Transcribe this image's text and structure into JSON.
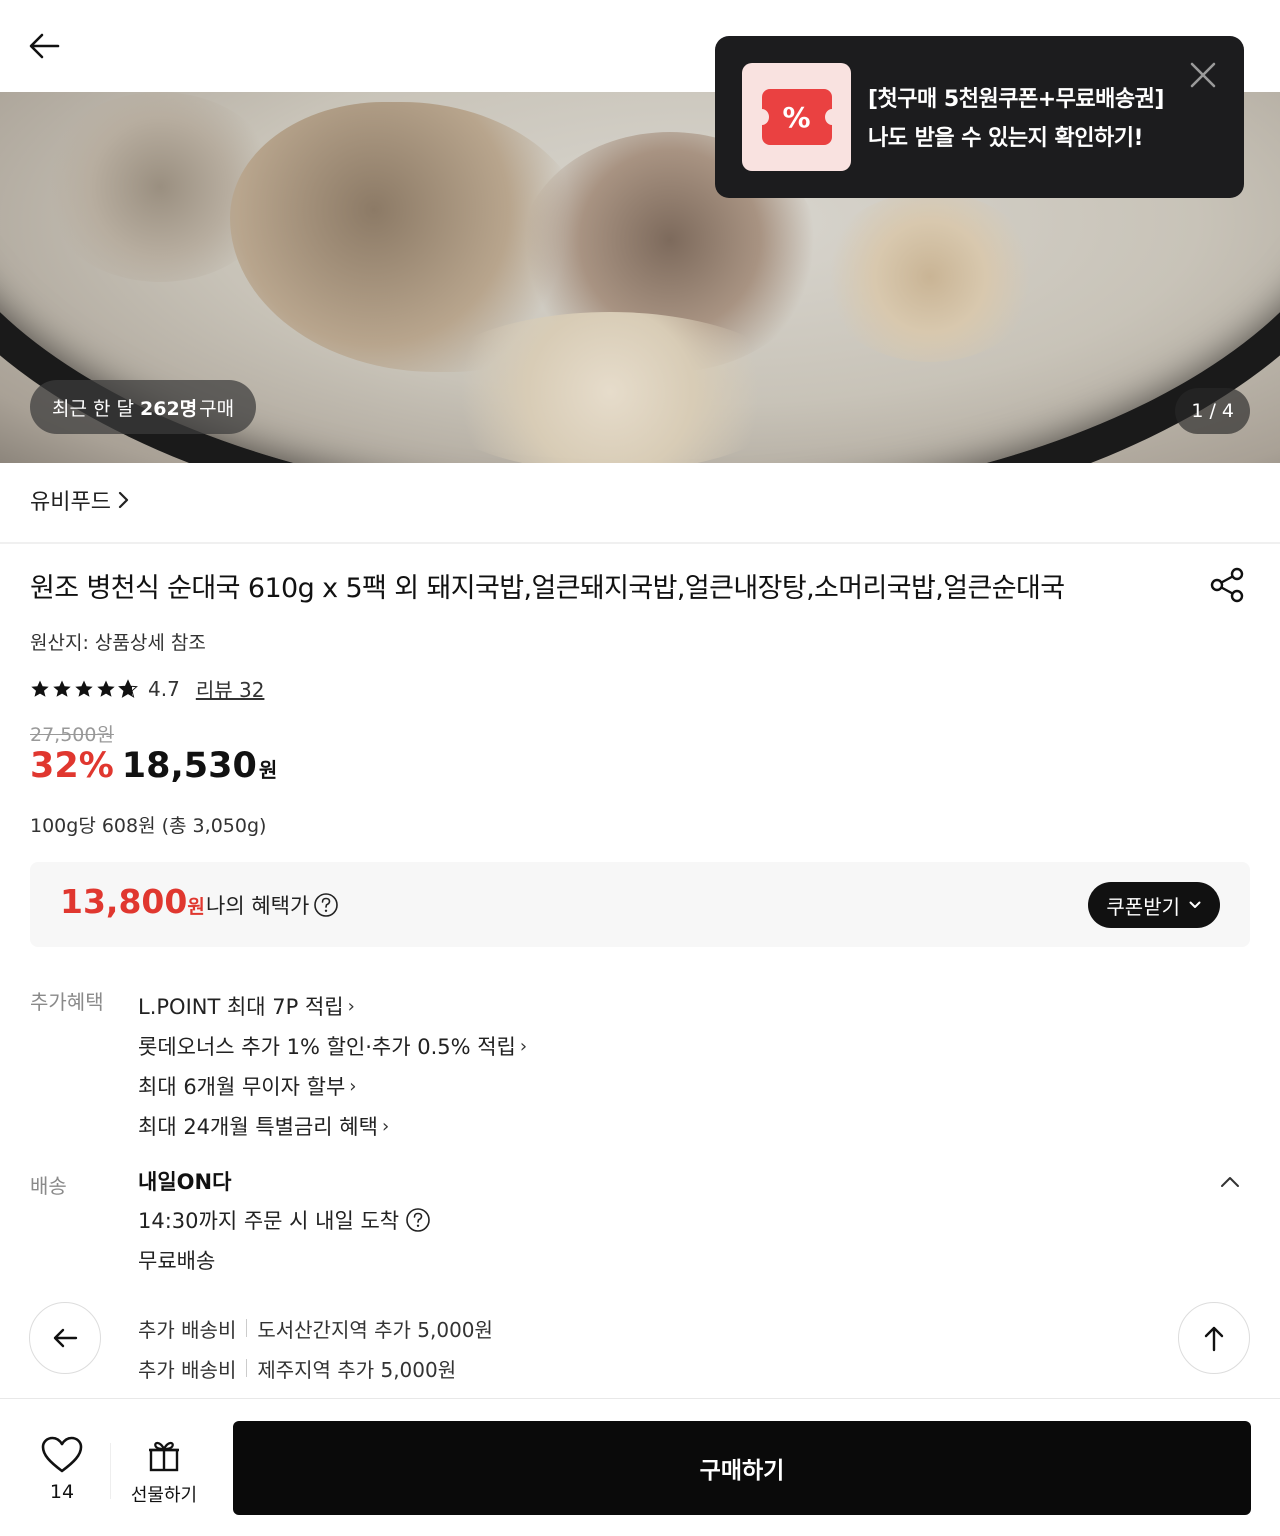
{
  "header": {
    "back_label": "뒤로가기"
  },
  "coupon_popup": {
    "icon_text": "%",
    "line1": "[첫구매 5천원쿠폰+무료배송권]",
    "line2": "나도 받을 수 있는지 확인하기!",
    "accent_color": "#ea4141"
  },
  "hero": {
    "buyers_prefix": "최근 한 달",
    "buyers_count": "262명",
    "buyers_suffix": "구매",
    "page_indicator": "1 / 4"
  },
  "brand": {
    "name": "유비푸드"
  },
  "product": {
    "title": "원조 병천식 순대국 610g x 5팩 외 돼지국밥,얼큰돼지국밥,얼큰내장탕,소머리국밥,얼큰순대국",
    "origin": "원산지: 상품상세 참조",
    "rating": "4.7",
    "rating_stars": 4.7,
    "review_link": "리뷰 32",
    "original_price": "27,500원",
    "discount": "32%",
    "price": "18,530",
    "price_unit": "원",
    "unit_price": "100g당 608원 (총 3,050g)"
  },
  "benefit": {
    "price": "13,800",
    "price_unit": "원",
    "label": "나의 혜택가",
    "coupon_button": "쿠폰받기",
    "accent_color": "#e0372f"
  },
  "extra_benefits": {
    "label": "추가혜택",
    "items": [
      "L.POINT 최대 7P 적립",
      "롯데오너스 추가 1% 할인·추가 0.5% 적립",
      "최대 6개월 무이자 할부",
      "최대 24개월 특별금리 혜택"
    ]
  },
  "shipping": {
    "label": "배송",
    "title": "내일ON다",
    "cutoff": "14:30까지 주문 시 내일 도착",
    "fee": "무료배송",
    "extra": [
      {
        "label": "추가 배송비",
        "value": "도서산간지역 추가 5,000원"
      },
      {
        "label": "추가 배송비",
        "value": "제주지역 추가 5,000원"
      }
    ]
  },
  "bottom_bar": {
    "wish_count": "14",
    "gift_label": "선물하기",
    "buy_label": "구매하기"
  }
}
